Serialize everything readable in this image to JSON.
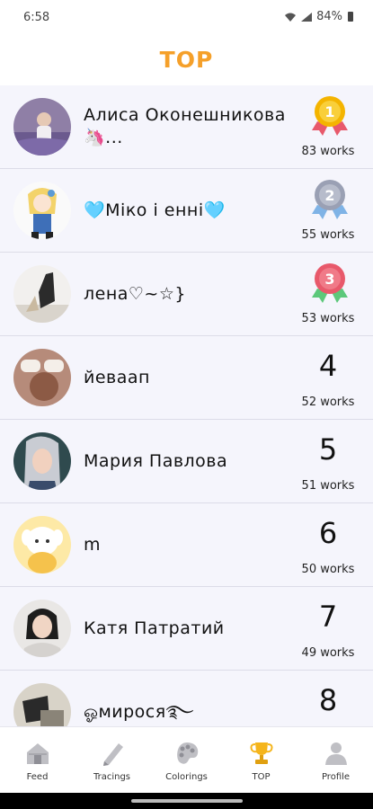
{
  "status": {
    "time": "6:58",
    "battery": "84%"
  },
  "header": {
    "title": "TOP"
  },
  "rows": [
    {
      "name": "Алиса Оконешникова 🦄...",
      "rank": "1",
      "works": "83 works",
      "medal": "gold"
    },
    {
      "name": "🩵Міко і енні🩵",
      "rank": "2",
      "works": "55 works",
      "medal": "silver"
    },
    {
      "name": "лена♡~☆}",
      "rank": "3",
      "works": "53 works",
      "medal": "bronze"
    },
    {
      "name": "йеваап",
      "rank": "4",
      "works": "52 works"
    },
    {
      "name": "Мария Павлова",
      "rank": "5",
      "works": "51 works"
    },
    {
      "name": "m",
      "rank": "6",
      "works": "50 works"
    },
    {
      "name": "Катя Патратий",
      "rank": "7",
      "works": "49 works"
    },
    {
      "name": "ஓмирося࿐",
      "rank": "8",
      "works": ""
    }
  ],
  "tabs": [
    {
      "label": "Feed",
      "icon": "house-icon"
    },
    {
      "label": "Tracings",
      "icon": "pencil-icon"
    },
    {
      "label": "Colorings",
      "icon": "palette-icon"
    },
    {
      "label": "TOP",
      "icon": "trophy-icon"
    },
    {
      "label": "Profile",
      "icon": "person-icon"
    }
  ],
  "colors": {
    "accent": "#f5a02a",
    "list_bg": "#f5f5fc",
    "gold": "#f4b400",
    "silver": "#9aa0b4",
    "bronze": "#e8596b"
  }
}
